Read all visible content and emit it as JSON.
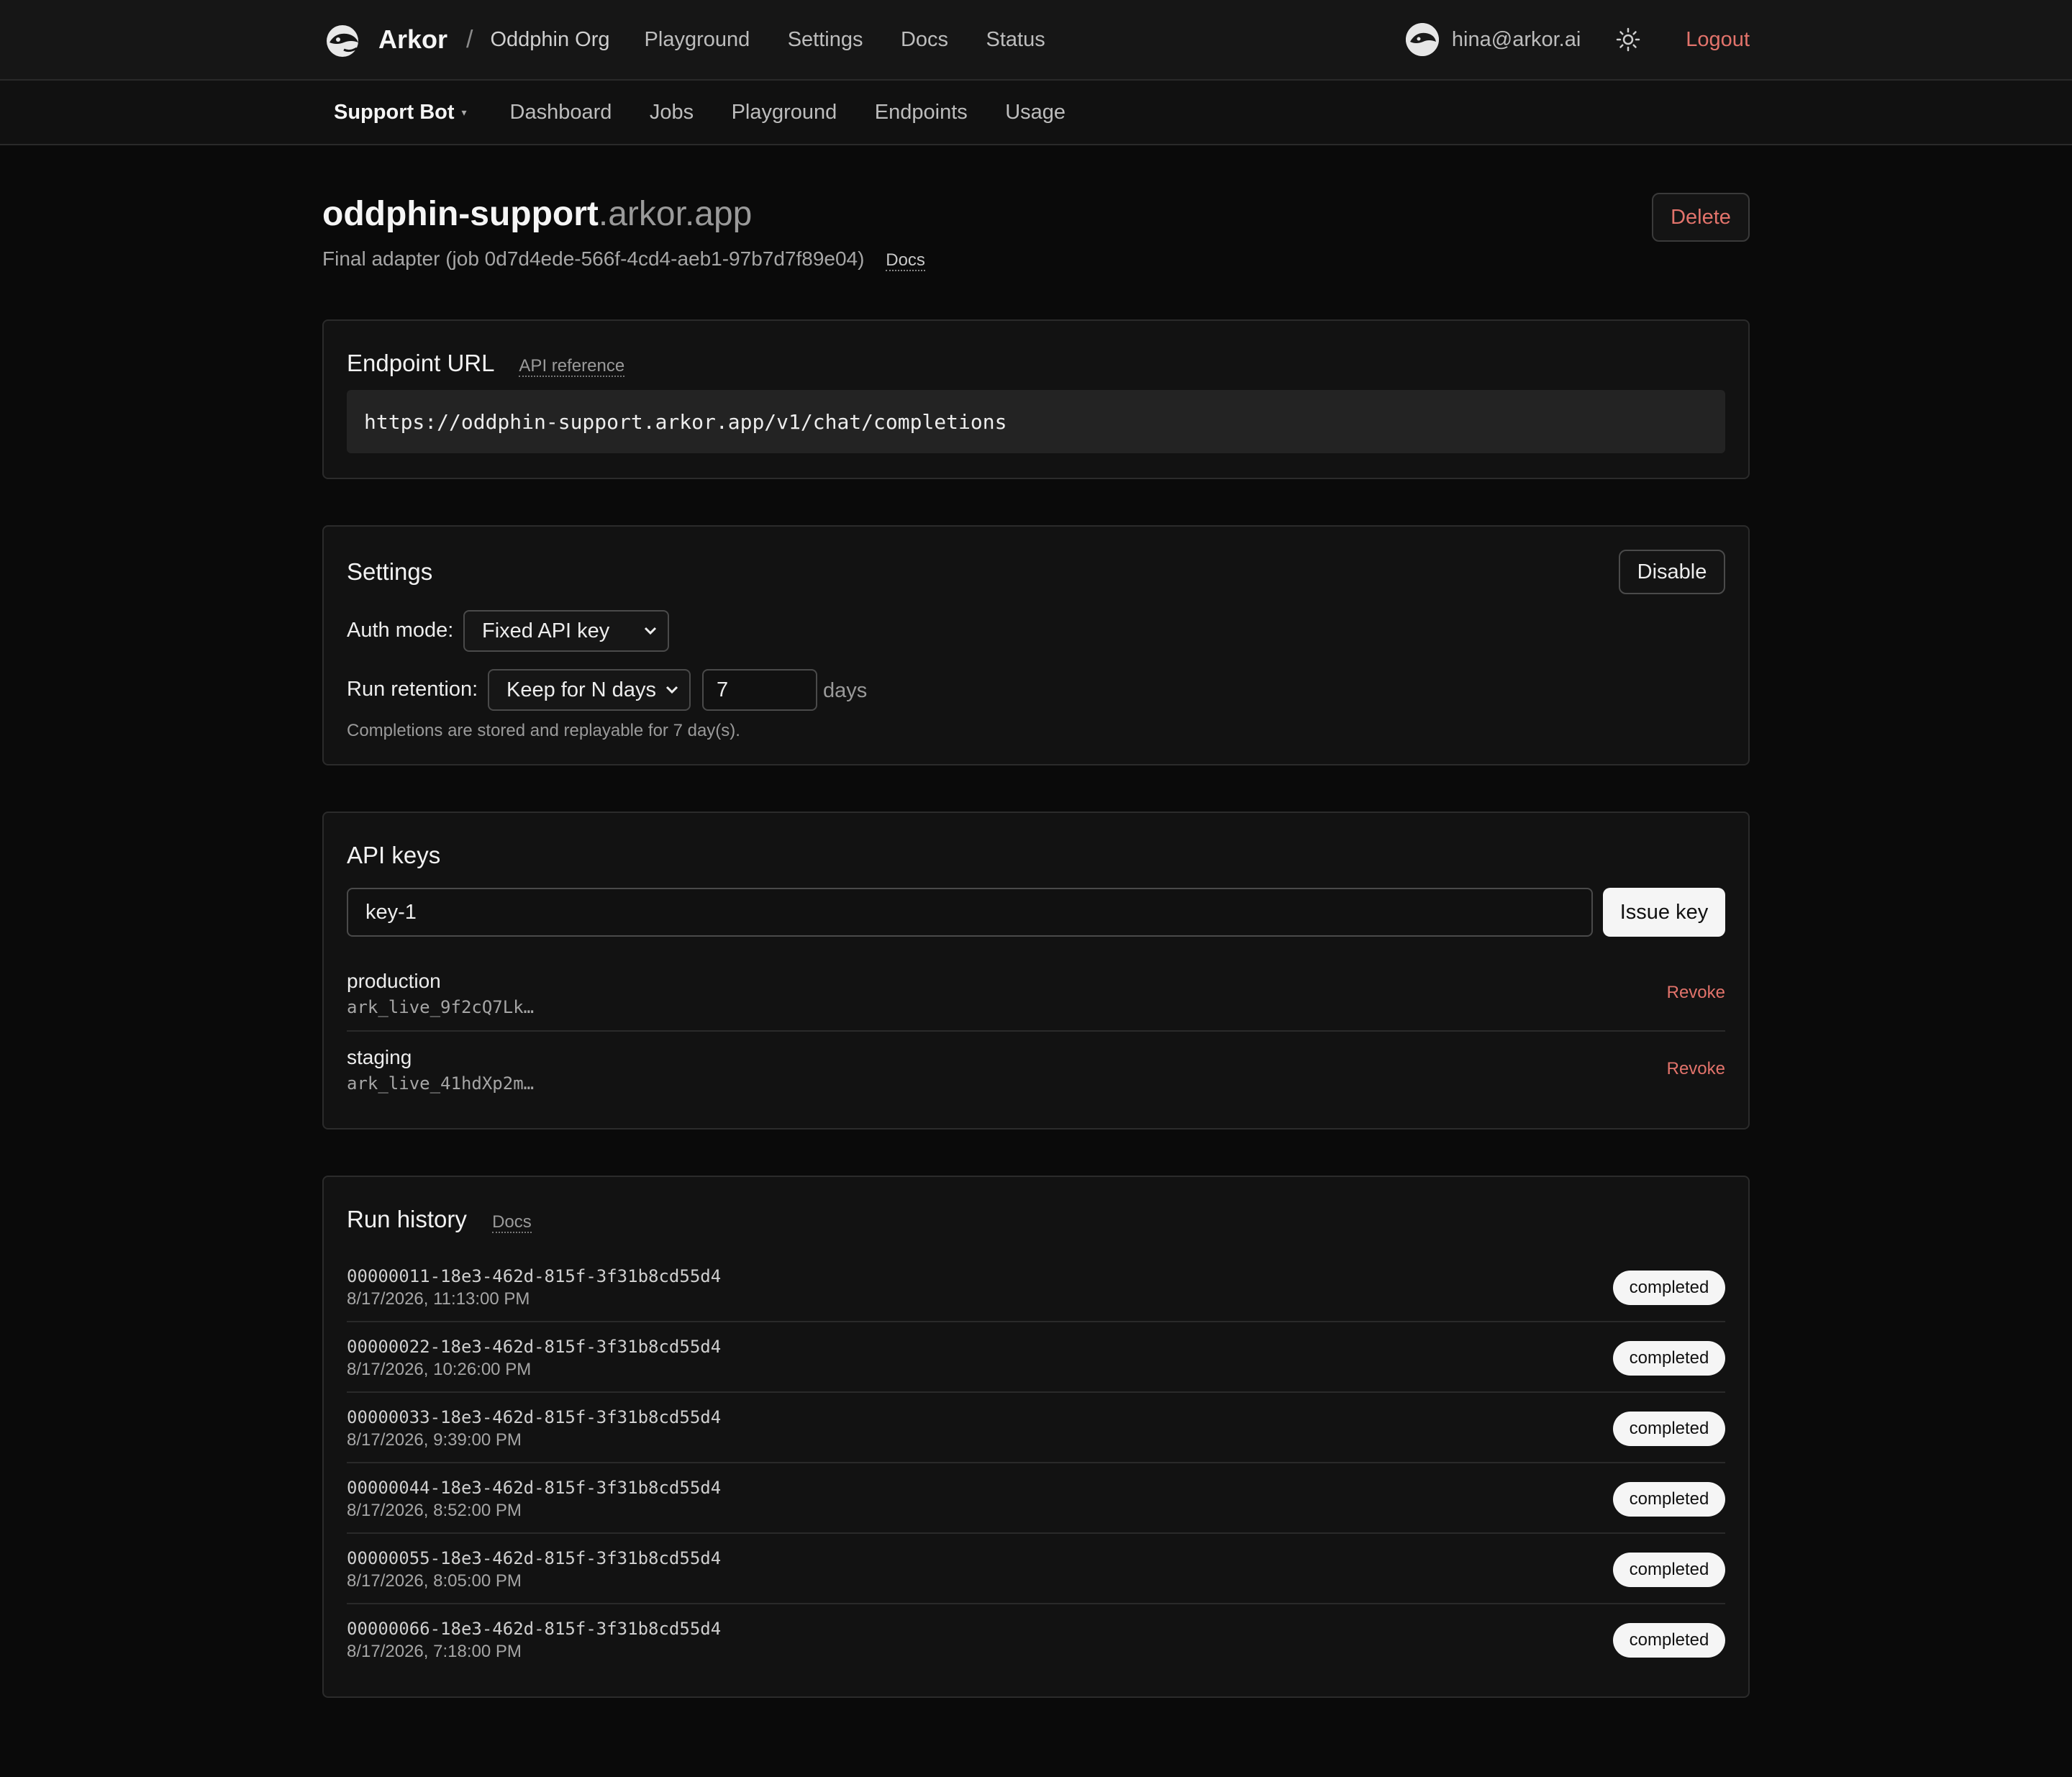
{
  "header": {
    "brand": "Arkor",
    "separator": "/",
    "org": "Oddphin Org",
    "nav": [
      "Playground",
      "Settings",
      "Docs",
      "Status"
    ],
    "user_email": "hina@arkor.ai",
    "logout_label": "Logout"
  },
  "subnav": {
    "project": "Support Bot",
    "caret": "▾",
    "items": [
      "Dashboard",
      "Jobs",
      "Playground",
      "Endpoints",
      "Usage"
    ]
  },
  "endpoint": {
    "name": "oddphin-support",
    "domain": ".arkor.app",
    "subtitle": "Final adapter (job 0d7d4ede-566f-4cd4-aeb1-97b7d7f89e04)",
    "docs_label": "Docs",
    "delete_label": "Delete"
  },
  "url_card": {
    "title": "Endpoint URL",
    "api_ref_label": "API reference",
    "url": "https://oddphin-support.arkor.app/v1/chat/completions"
  },
  "settings": {
    "title": "Settings",
    "disable_label": "Disable",
    "auth_label": "Auth mode:",
    "auth_value": "Fixed API key",
    "retention_label": "Run retention:",
    "retention_mode": "Keep for N days",
    "retention_days": "7",
    "days_unit": "days",
    "note": "Completions are stored and replayable for 7 day(s)."
  },
  "api_keys": {
    "title": "API keys",
    "input_value": "key-1",
    "issue_label": "Issue key",
    "keys": [
      {
        "name": "production",
        "prefix": "ark_live_9f2cQ7Lk…",
        "action": "Revoke"
      },
      {
        "name": "staging",
        "prefix": "ark_live_41hdXp2m…",
        "action": "Revoke"
      }
    ]
  },
  "run_history": {
    "title": "Run history",
    "docs_label": "Docs",
    "runs": [
      {
        "id": "00000011-18e3-462d-815f-3f31b8cd55d4",
        "time": "8/17/2026, 11:13:00 PM",
        "status": "completed"
      },
      {
        "id": "00000022-18e3-462d-815f-3f31b8cd55d4",
        "time": "8/17/2026, 10:26:00 PM",
        "status": "completed"
      },
      {
        "id": "00000033-18e3-462d-815f-3f31b8cd55d4",
        "time": "8/17/2026, 9:39:00 PM",
        "status": "completed"
      },
      {
        "id": "00000044-18e3-462d-815f-3f31b8cd55d4",
        "time": "8/17/2026, 8:52:00 PM",
        "status": "completed"
      },
      {
        "id": "00000055-18e3-462d-815f-3f31b8cd55d4",
        "time": "8/17/2026, 8:05:00 PM",
        "status": "completed"
      },
      {
        "id": "00000066-18e3-462d-815f-3f31b8cd55d4",
        "time": "8/17/2026, 7:18:00 PM",
        "status": "completed"
      }
    ]
  },
  "icons": {
    "logo": "dolphin-logo-icon",
    "theme": "sun-icon",
    "avatar": "avatar-icon"
  }
}
